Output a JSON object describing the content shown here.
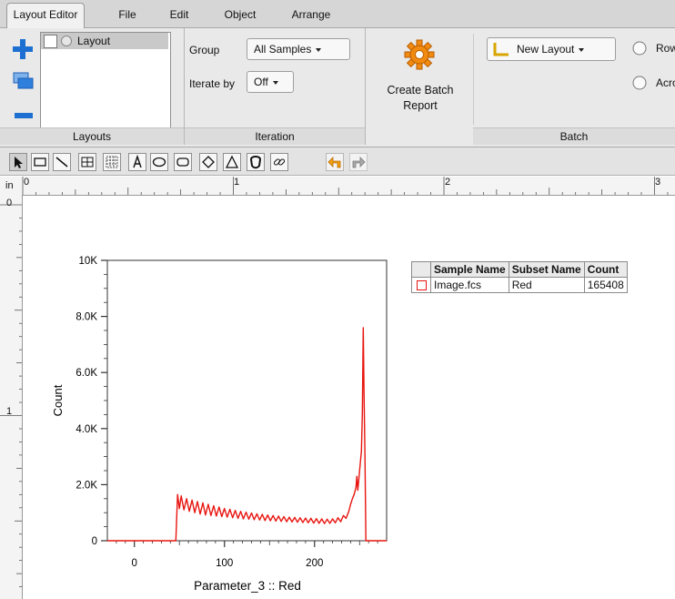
{
  "tabs": [
    {
      "label": "Layout Editor",
      "active": true
    },
    {
      "label": "File"
    },
    {
      "label": "Edit"
    },
    {
      "label": "Object"
    },
    {
      "label": "Arrange"
    }
  ],
  "layouts_group": {
    "title": "Layouts",
    "items": [
      {
        "label": "Layout"
      }
    ]
  },
  "iteration_group": {
    "title": "Iteration",
    "group_label": "Group",
    "group_value": "All Samples",
    "iterate_label": "Iterate by",
    "iterate_value": "Off"
  },
  "batch_group": {
    "title": "Batch",
    "create_batch_line1": "Create Batch",
    "create_batch_line2": "Report",
    "new_layout_label": "New Layout",
    "radio_1": "Row",
    "radio_2": "Acro"
  },
  "ruler": {
    "unit": "in",
    "top_ticks": [
      "0",
      "1",
      "2",
      "3"
    ],
    "left_ticks": [
      "0",
      "1"
    ]
  },
  "chart_data": {
    "type": "line",
    "xlabel": "Parameter_3 :: Red",
    "ylabel": "Count",
    "x_ticks": [
      "0",
      "100",
      "200"
    ],
    "x_tick_values": [
      0,
      100,
      200
    ],
    "xlim": [
      -30,
      280
    ],
    "y_ticks": [
      "0",
      "2.0K",
      "4.0K",
      "6.0K",
      "8.0K",
      "10K"
    ],
    "y_tick_values": [
      0,
      2000,
      4000,
      6000,
      8000,
      10000
    ],
    "ylim": [
      0,
      10000
    ],
    "line_color": "#e8150f",
    "series": [
      {
        "points": [
          [
            -30,
            0
          ],
          [
            46,
            0
          ],
          [
            48,
            1650
          ],
          [
            50,
            1150
          ],
          [
            52,
            1600
          ],
          [
            55,
            1100
          ],
          [
            58,
            1500
          ],
          [
            61,
            1050
          ],
          [
            64,
            1450
          ],
          [
            67,
            1000
          ],
          [
            70,
            1400
          ],
          [
            73,
            950
          ],
          [
            76,
            1350
          ],
          [
            79,
            920
          ],
          [
            82,
            1300
          ],
          [
            85,
            900
          ],
          [
            88,
            1250
          ],
          [
            91,
            880
          ],
          [
            94,
            1200
          ],
          [
            97,
            860
          ],
          [
            100,
            1150
          ],
          [
            103,
            840
          ],
          [
            106,
            1120
          ],
          [
            109,
            820
          ],
          [
            112,
            1080
          ],
          [
            115,
            800
          ],
          [
            118,
            1050
          ],
          [
            121,
            780
          ],
          [
            124,
            1020
          ],
          [
            127,
            770
          ],
          [
            130,
            990
          ],
          [
            133,
            750
          ],
          [
            136,
            960
          ],
          [
            139,
            740
          ],
          [
            142,
            940
          ],
          [
            145,
            720
          ],
          [
            148,
            920
          ],
          [
            151,
            710
          ],
          [
            154,
            900
          ],
          [
            157,
            700
          ],
          [
            160,
            880
          ],
          [
            163,
            690
          ],
          [
            166,
            860
          ],
          [
            169,
            680
          ],
          [
            172,
            840
          ],
          [
            175,
            670
          ],
          [
            178,
            830
          ],
          [
            181,
            660
          ],
          [
            184,
            820
          ],
          [
            187,
            650
          ],
          [
            190,
            810
          ],
          [
            193,
            640
          ],
          [
            196,
            800
          ],
          [
            199,
            630
          ],
          [
            202,
            790
          ],
          [
            205,
            620
          ],
          [
            208,
            780
          ],
          [
            211,
            610
          ],
          [
            214,
            770
          ],
          [
            217,
            620
          ],
          [
            220,
            780
          ],
          [
            223,
            640
          ],
          [
            226,
            820
          ],
          [
            229,
            680
          ],
          [
            232,
            900
          ],
          [
            235,
            800
          ],
          [
            238,
            1050
          ],
          [
            240,
            1300
          ],
          [
            242,
            1500
          ],
          [
            244,
            1650
          ],
          [
            246,
            1900
          ],
          [
            247,
            2300
          ],
          [
            248,
            1800
          ],
          [
            250,
            2500
          ],
          [
            252,
            3200
          ],
          [
            253,
            4500
          ],
          [
            254,
            7600
          ],
          [
            255,
            5200
          ],
          [
            256,
            3000
          ],
          [
            257,
            0
          ],
          [
            280,
            0
          ]
        ]
      }
    ]
  },
  "table": {
    "headers": [
      "",
      "Sample Name",
      "Subset Name",
      "Count"
    ],
    "rows": [
      {
        "sample": "Image.fcs",
        "subset": "Red",
        "count": "165408"
      }
    ]
  }
}
